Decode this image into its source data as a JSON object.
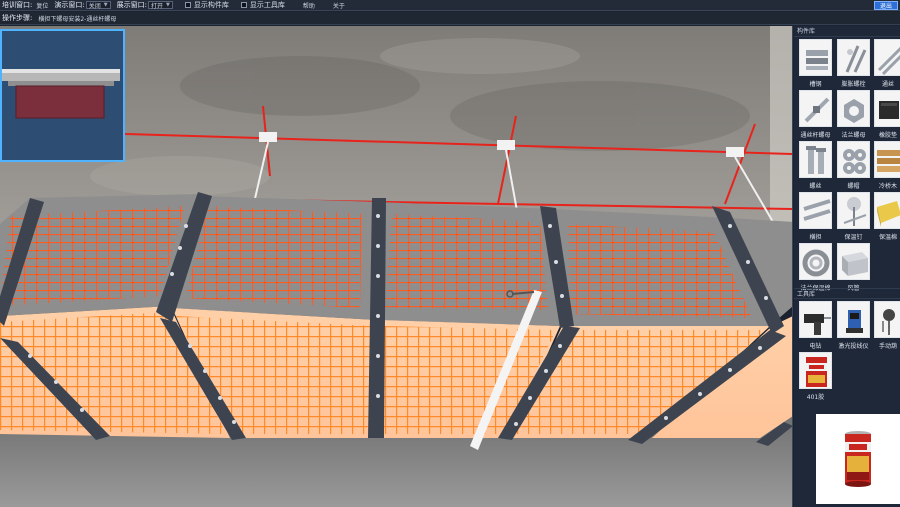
{
  "toolbar": {
    "training_label": "培训窗口:",
    "reset_label": "复位",
    "demo_label": "演示窗口:",
    "demo_value": "关闭",
    "display_label": "展示窗口:",
    "display_value": "打开",
    "show_parts_label": "显示构件库",
    "show_tools_label": "显示工具库",
    "help_label": "帮助",
    "about_label": "关于",
    "exit_label": "退出"
  },
  "stepbar": {
    "label": "操作步骤:",
    "value": "横担下螺母安装2-通丝杆螺母"
  },
  "parts_library": {
    "title": "构件库",
    "items": [
      {
        "label": "槽钢",
        "icon": "channel-steel-icon"
      },
      {
        "label": "膨胀螺栓",
        "icon": "expansion-bolt-icon"
      },
      {
        "label": "通丝",
        "icon": "threaded-rod-icon"
      },
      {
        "label": "通丝杆螺母",
        "icon": "rod-nut-icon"
      },
      {
        "label": "法兰螺母",
        "icon": "flange-nut-icon"
      },
      {
        "label": "橡胶垫",
        "icon": "rubber-pad-icon"
      },
      {
        "label": "螺丝",
        "icon": "screw-icon"
      },
      {
        "label": "螺帽",
        "icon": "nut-cap-icon"
      },
      {
        "label": "冷桥木",
        "icon": "cold-bridge-wood-icon"
      },
      {
        "label": "横担",
        "icon": "crossarm-icon"
      },
      {
        "label": "保温钉",
        "icon": "insulation-nail-icon"
      },
      {
        "label": "保温棉",
        "icon": "insulation-wool-icon"
      },
      {
        "label": "法兰保温棉",
        "icon": "flange-insulation-icon"
      },
      {
        "label": "风管",
        "icon": "air-duct-icon"
      }
    ]
  },
  "tools_library": {
    "title": "工具库",
    "items": [
      {
        "label": "电钻",
        "icon": "electric-drill-icon"
      },
      {
        "label": "激光投线仪",
        "icon": "laser-level-icon"
      },
      {
        "label": "手动葫",
        "icon": "chain-hoist-icon"
      },
      {
        "label": "401胶",
        "icon": "glue-401-icon"
      }
    ]
  },
  "preview": {
    "icon": "glue-401-preview-icon"
  },
  "colors": {
    "accent": "#2d6fd6",
    "mesh": "#ff5a1f",
    "laser": "#e8231c",
    "minimap_border": "#4fb3ff"
  }
}
